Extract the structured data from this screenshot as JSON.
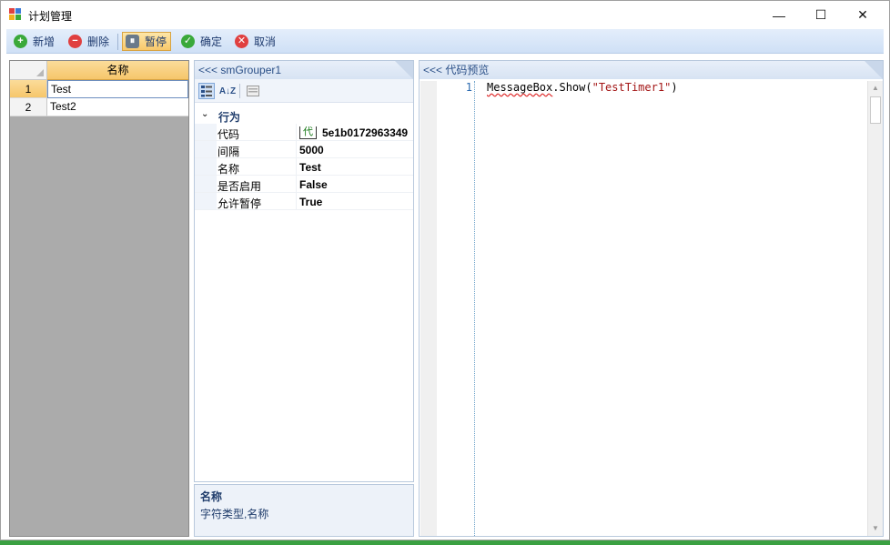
{
  "window": {
    "title": "计划管理",
    "controls": {
      "minimize": "—",
      "maximize": "☐",
      "close": "✕"
    }
  },
  "toolbar": {
    "add_label": "新增",
    "delete_label": "删除",
    "pause_label": "暂停",
    "confirm_label": "确定",
    "cancel_label": "取消",
    "active_button": "pause",
    "colors": {
      "add": "#3aa93a",
      "delete": "#e04040",
      "confirm": "#3aa93a",
      "cancel": "#e04040"
    }
  },
  "grid": {
    "column_header": "名称",
    "rows": [
      {
        "num": "1",
        "name": "Test",
        "selected": true
      },
      {
        "num": "2",
        "name": "Test2",
        "selected": false
      }
    ]
  },
  "property_panel": {
    "header": "<<< smGrouper1",
    "tool_icons": [
      "categorized-icon",
      "alphabetical-sort-icon",
      "property-pages-icon"
    ],
    "sort_icon_glyph": "A↓Z",
    "category": {
      "arrow": "⌄",
      "label": "行为"
    },
    "code_badge": "代",
    "properties": [
      {
        "name": "代码",
        "value": "5e1b0172963349"
      },
      {
        "name": "间隔",
        "value": "5000"
      },
      {
        "name": "名称",
        "value": "Test"
      },
      {
        "name": "是否启用",
        "value": "False"
      },
      {
        "name": "允许暂停",
        "value": "True"
      }
    ]
  },
  "description": {
    "title": "名称",
    "text": "字符类型,名称"
  },
  "code_preview": {
    "header": "<<< 代码预览",
    "line_number": "1",
    "tokens": {
      "ident": "MessageBox",
      "dot": ".",
      "method": "Show(",
      "string": "\"TestTimer1\"",
      "close": ")"
    },
    "scroll_up": "▲",
    "scroll_down": "▼"
  }
}
